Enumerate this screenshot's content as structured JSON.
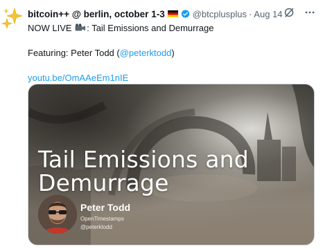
{
  "tweet": {
    "display_name": "bitcoin++ @ berlin, october 1-3",
    "handle": "@btcplusplus",
    "separator": "·",
    "time": "Aug 14",
    "text_line1_prefix": "NOW LIVE",
    "text_line1_suffix": ": Tail Emissions and Demurrage",
    "featuring_prefix": "Featuring: Peter Todd (",
    "featuring_mention": "@peterktodd",
    "featuring_suffix": ")",
    "link": "youtu.be/OmAAeEm1nIE"
  },
  "card": {
    "title": "Tail Emissions and Demurrage",
    "speaker_name": "Peter Todd",
    "speaker_org": "OpenTimestamps",
    "speaker_handle": "@peterktodd"
  },
  "icons": {
    "avatar": "sparkles-icon",
    "flag": "germany-flag-icon",
    "verified": "verified-badge-icon",
    "grok": "grok-icon",
    "more": "more-icon",
    "camera": "video-camera-icon"
  },
  "colors": {
    "link": "#1d9bf0",
    "secondary_text": "#536471",
    "verified": "#1d9bf0"
  }
}
